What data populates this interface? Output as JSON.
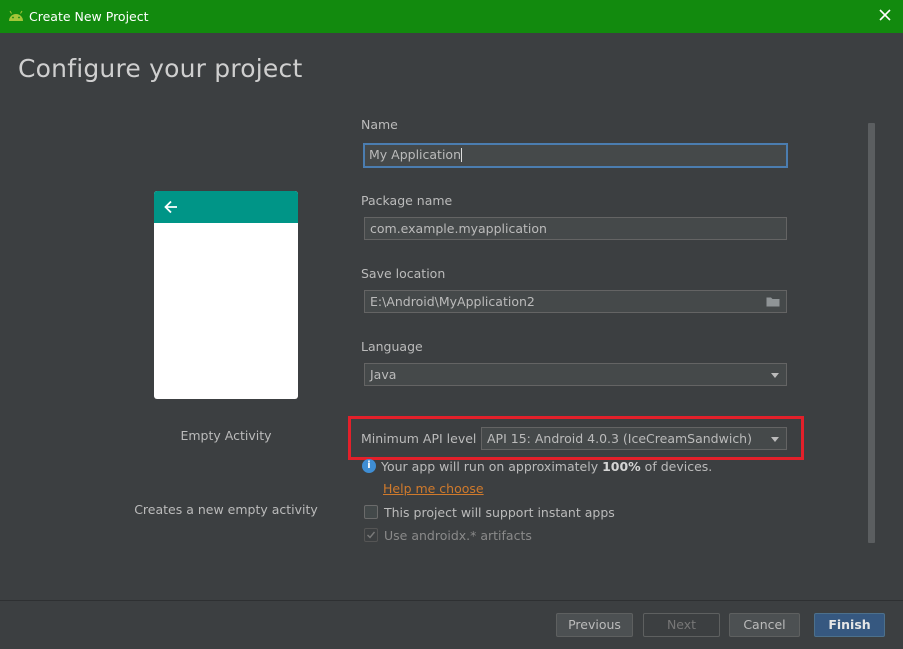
{
  "window": {
    "title": "Create New Project"
  },
  "page": {
    "heading": "Configure your project"
  },
  "preview": {
    "activity_name": "Empty Activity",
    "activity_description": "Creates a new empty activity"
  },
  "form": {
    "name": {
      "label": "Name",
      "value": "My Application"
    },
    "package": {
      "label": "Package name",
      "value": "com.example.myapplication"
    },
    "save_location": {
      "label": "Save location",
      "value": "E:\\Android\\MyApplication2"
    },
    "language": {
      "label": "Language",
      "value": "Java"
    },
    "min_api": {
      "label": "Minimum API level",
      "value": "API 15: Android 4.0.3 (IceCreamSandwich)"
    }
  },
  "info": {
    "prefix": "Your app will run on approximately ",
    "percent": "100%",
    "suffix": " of devices.",
    "help_link": "Help me choose"
  },
  "options": {
    "instant_apps": {
      "label": "This project will support instant apps",
      "checked": false
    },
    "androidx": {
      "label": "Use androidx.* artifacts",
      "checked": true,
      "disabled": true
    }
  },
  "buttons": {
    "previous": "Previous",
    "next": "Next",
    "cancel": "Cancel",
    "finish": "Finish"
  },
  "colors": {
    "titlebar": "#128a0e",
    "toolbar_preview": "#009587",
    "highlight": "#e3202a",
    "link": "#d07a2c"
  }
}
